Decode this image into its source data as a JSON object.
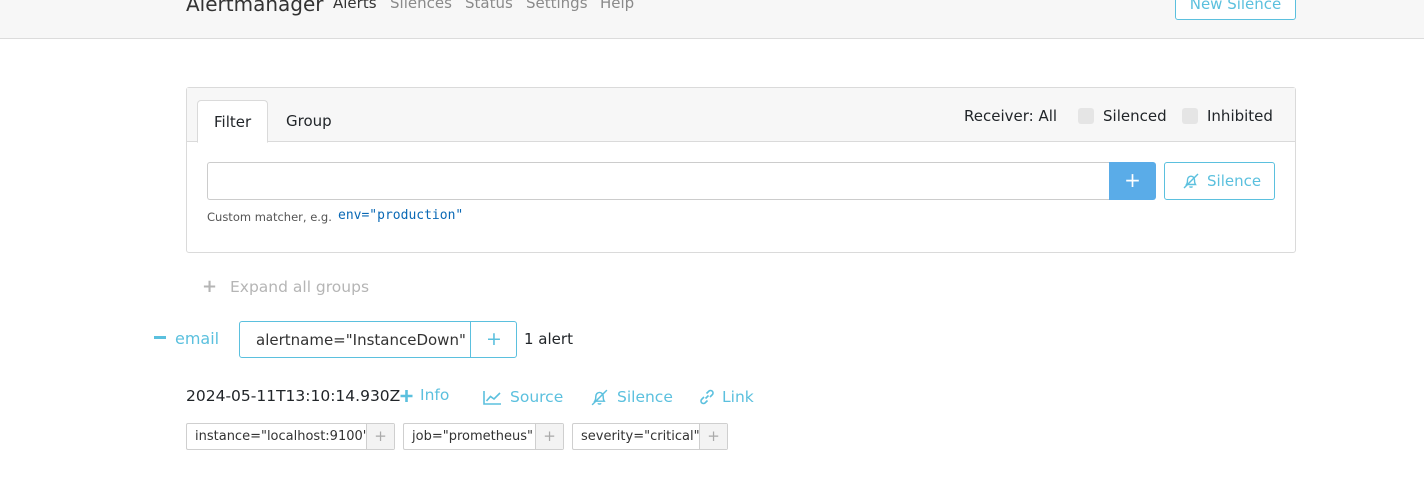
{
  "navbar": {
    "brand": "Alertmanager",
    "links": [
      "Alerts",
      "Silences",
      "Status",
      "Settings",
      "Help"
    ],
    "new_silence": "New Silence"
  },
  "filter_card": {
    "tabs": [
      "Filter",
      "Group"
    ],
    "receiver": "Receiver: All",
    "silenced_label": "Silenced",
    "inhibited_label": "Inhibited",
    "input_value": "",
    "add_button": "+",
    "silence_button": "Silence",
    "hint": "Custom matcher, e.g.",
    "hint_example": "env=\"production\""
  },
  "expand_all": "Expand all groups",
  "group": {
    "receiver": "email",
    "matcher": "alertname=\"InstanceDown\"",
    "matcher_plus": "+",
    "count": "1 alert"
  },
  "alert": {
    "timestamp": "2024-05-11T13:10:14.930Z",
    "actions": {
      "info": "Info",
      "source": "Source",
      "silence": "Silence",
      "link": "Link"
    },
    "labels": [
      {
        "text": "instance=\"localhost:9100\"",
        "plus": "+"
      },
      {
        "text": "job=\"prometheus\"",
        "plus": "+"
      },
      {
        "text": "severity=\"critical\"",
        "plus": "+"
      }
    ]
  },
  "colors": {
    "accent": "#5bc0de",
    "primary_button": "#5aace8",
    "code": "#0a69b5"
  }
}
